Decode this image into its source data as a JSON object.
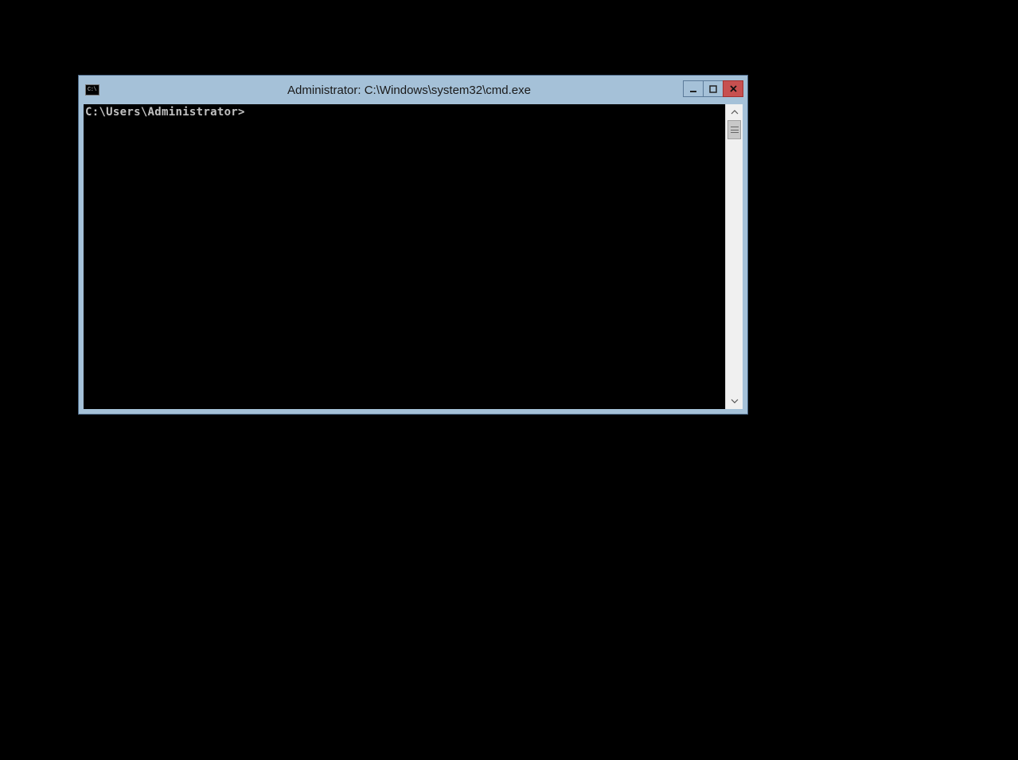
{
  "window": {
    "title": "Administrator: C:\\Windows\\system32\\cmd.exe",
    "icon_label": "C:\\"
  },
  "console": {
    "prompt": "C:\\Users\\Administrator>"
  }
}
